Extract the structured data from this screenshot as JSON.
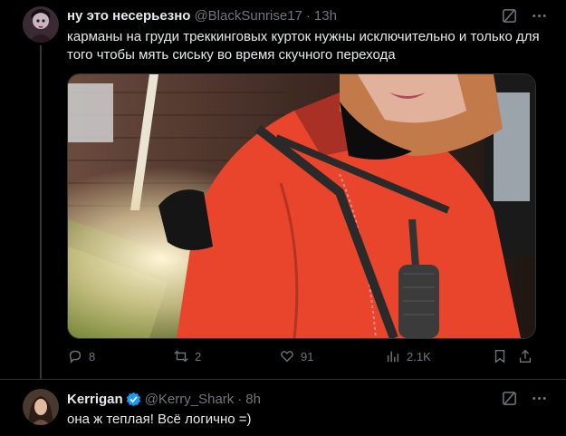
{
  "tweet1": {
    "name": "ну это несерьезно",
    "handle": "@BlackSunrise17",
    "dot": "·",
    "time": "13h",
    "text": "карманы на груди треккинговых курток нужны исключительно и только для того чтобы мять сиську во время скучного перехода",
    "stats": {
      "replies": "8",
      "reposts": "2",
      "likes": "91",
      "views": "2.1K"
    }
  },
  "tweet2": {
    "name": "Kerrigan",
    "handle": "@Kerry_Shark",
    "dot": "·",
    "time": "8h",
    "text": "она ж теплая! Всё логично =)"
  },
  "colors": {
    "background": "#000000",
    "text": "#e7e9ea",
    "muted": "#71767b",
    "verified": "#1d9bf0",
    "jacket": "#e8452c"
  },
  "icons": [
    "grok-icon",
    "more-icon",
    "reply-icon",
    "repost-icon",
    "like-icon",
    "views-icon",
    "bookmark-icon",
    "share-icon",
    "verified-badge-icon"
  ]
}
